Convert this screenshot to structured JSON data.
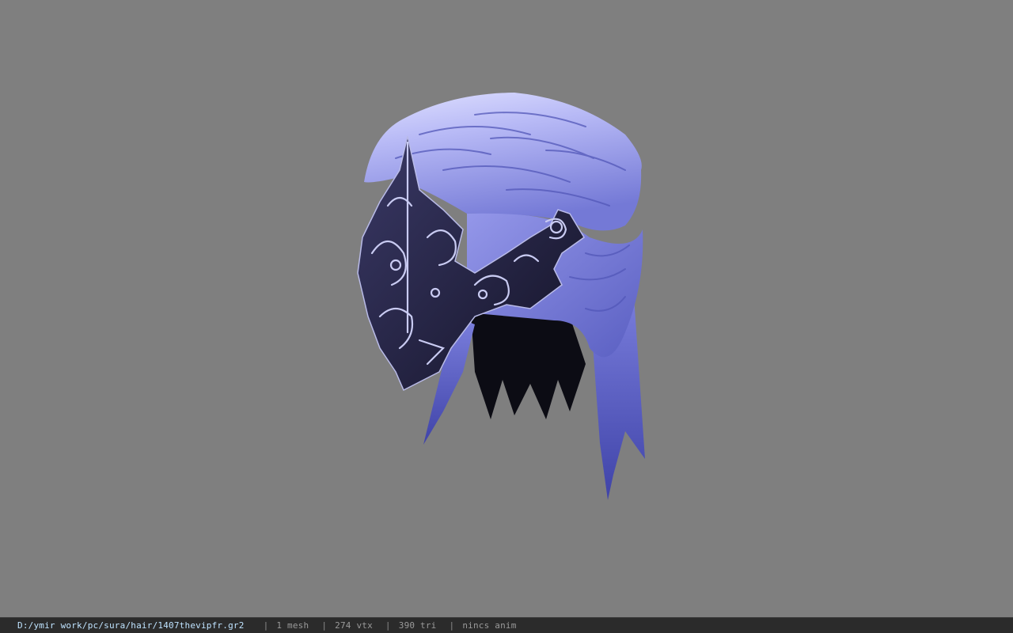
{
  "status_bar": {
    "file_path": "D:/ymir work/pc/sura/hair/1407thevipfr.gr2",
    "separator": "|",
    "mesh": "1 mesh",
    "vertices": "274 vtx",
    "triangles": "390 tri",
    "anim": "nincs anim"
  },
  "colors": {
    "viewport_bg": "#7f7f7f",
    "hair": "#8a8ee6",
    "hair_highlight": "#e7e8ff",
    "metal": "#1e1d3a"
  }
}
